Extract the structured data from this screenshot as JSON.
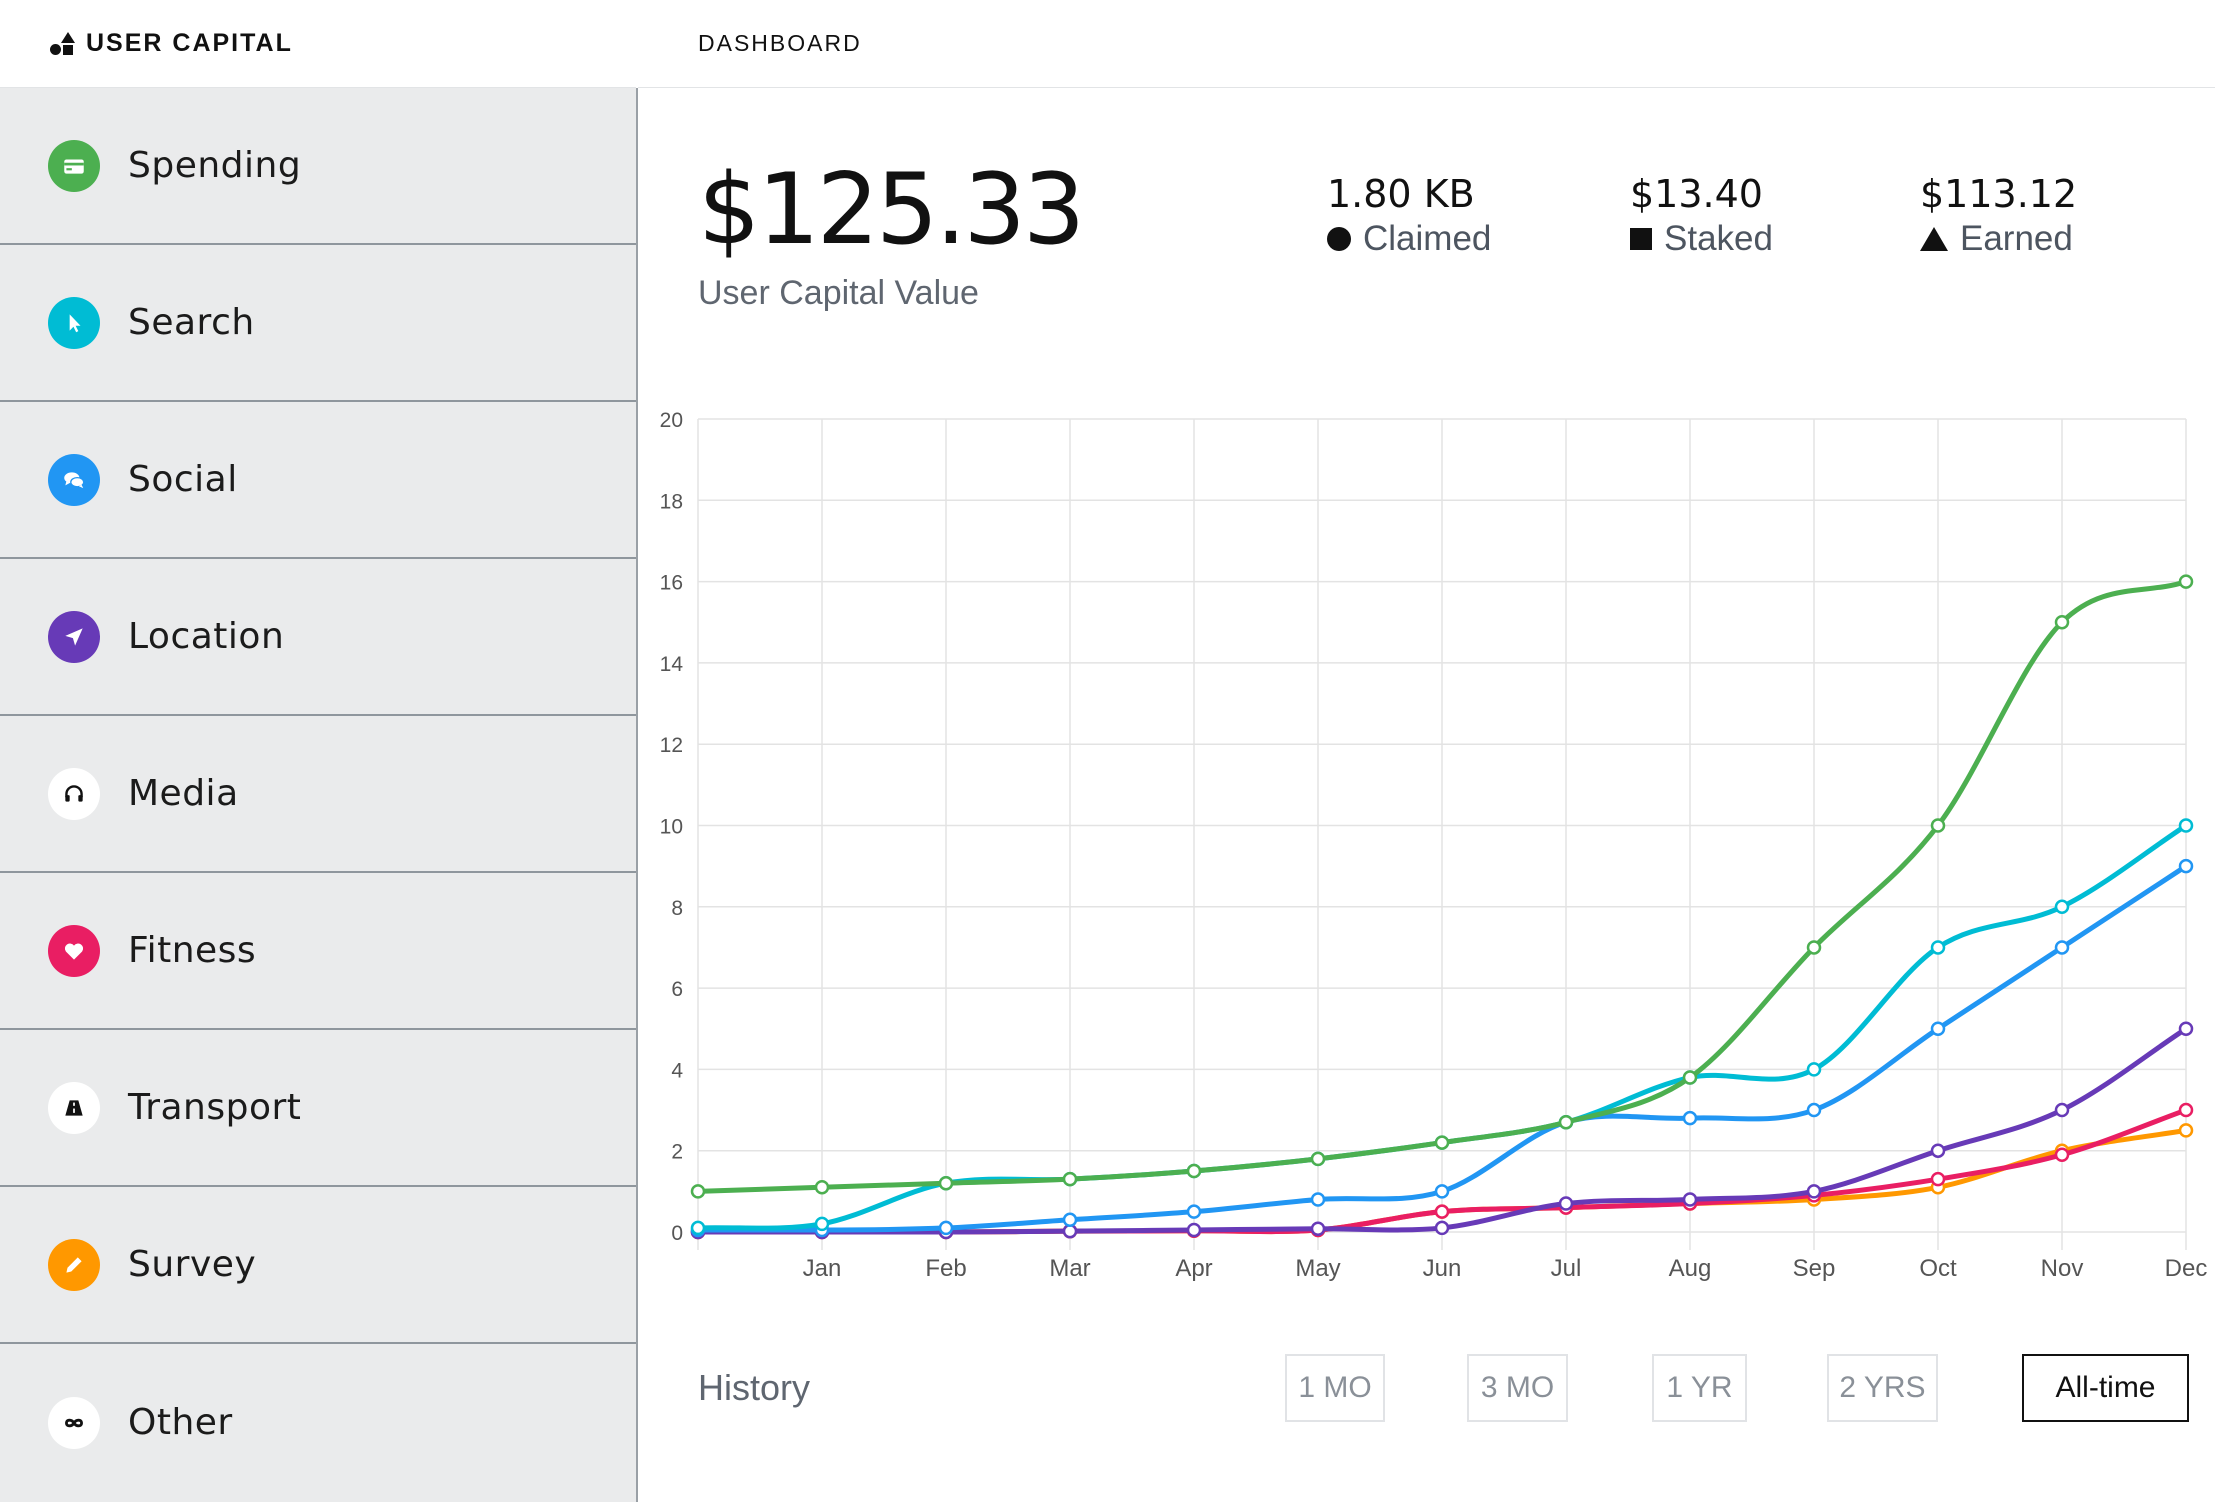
{
  "brand": {
    "name": "USER CAPITAL"
  },
  "header": {
    "title": "DASHBOARD"
  },
  "sidebar": {
    "items": [
      {
        "label": "Spending",
        "icon": "credit-card-icon",
        "color": "#4caf50"
      },
      {
        "label": "Search",
        "icon": "cursor-icon",
        "color": "#00bcd4"
      },
      {
        "label": "Social",
        "icon": "chat-bubbles-icon",
        "color": "#2196f3"
      },
      {
        "label": "Location",
        "icon": "navigation-arrow-icon",
        "color": "#673ab7"
      },
      {
        "label": "Media",
        "icon": "headphones-icon",
        "color": "#ffffff"
      },
      {
        "label": "Fitness",
        "icon": "heart-icon",
        "color": "#e91e63"
      },
      {
        "label": "Transport",
        "icon": "road-icon",
        "color": "#ffffff"
      },
      {
        "label": "Survey",
        "icon": "pencil-icon",
        "color": "#ff9800"
      },
      {
        "label": "Other",
        "icon": "infinity-icon",
        "color": "#ffffff"
      }
    ]
  },
  "summary": {
    "total": "$125.33",
    "total_label": "User Capital Value",
    "stats": [
      {
        "value": "1.80 KB",
        "label": "Claimed",
        "marker": "circle"
      },
      {
        "value": "$13.40",
        "label": "Staked",
        "marker": "square"
      },
      {
        "value": "$113.12",
        "label": "Earned",
        "marker": "triangle"
      }
    ]
  },
  "history": {
    "label": "History",
    "ranges": [
      "1 MO",
      "3 MO",
      "1 YR",
      "2 YRS",
      "All-time"
    ],
    "selected": "All-time"
  },
  "chart_data": {
    "type": "line",
    "x": [
      "",
      "Jan",
      "Feb",
      "Mar",
      "Apr",
      "May",
      "Jun",
      "Jul",
      "Aug",
      "Sep",
      "Oct",
      "Nov",
      "Dec"
    ],
    "ylim": [
      0,
      20
    ],
    "yticks": [
      0,
      2,
      4,
      6,
      8,
      10,
      12,
      14,
      16,
      18,
      20
    ],
    "grid": true,
    "series": [
      {
        "color": "#4caf50",
        "values": [
          1,
          1.1,
          1.2,
          1.3,
          1.5,
          1.8,
          2.2,
          2.7,
          3.8,
          7,
          10,
          15,
          16
        ]
      },
      {
        "color": "#00bcd4",
        "values": [
          0.1,
          0.2,
          1.2,
          1.3,
          1.5,
          1.8,
          2.2,
          2.7,
          3.8,
          4,
          7,
          8,
          10
        ]
      },
      {
        "color": "#2196f3",
        "values": [
          0.05,
          0.05,
          0.1,
          0.3,
          0.5,
          0.8,
          1,
          2.7,
          2.8,
          3,
          5,
          7,
          9
        ]
      },
      {
        "color": "#ff9800",
        "values": [
          0,
          0,
          0,
          0.02,
          0.03,
          0.05,
          0.5,
          0.6,
          0.7,
          0.8,
          1.1,
          2,
          2.5
        ]
      },
      {
        "color": "#e91e63",
        "values": [
          0,
          0,
          0,
          0.02,
          0.03,
          0.05,
          0.5,
          0.6,
          0.7,
          0.9,
          1.3,
          1.9,
          3
        ]
      },
      {
        "color": "#673ab7",
        "values": [
          0,
          0,
          0,
          0.02,
          0.05,
          0.08,
          0.1,
          0.7,
          0.8,
          1,
          2,
          3,
          5
        ]
      }
    ]
  }
}
